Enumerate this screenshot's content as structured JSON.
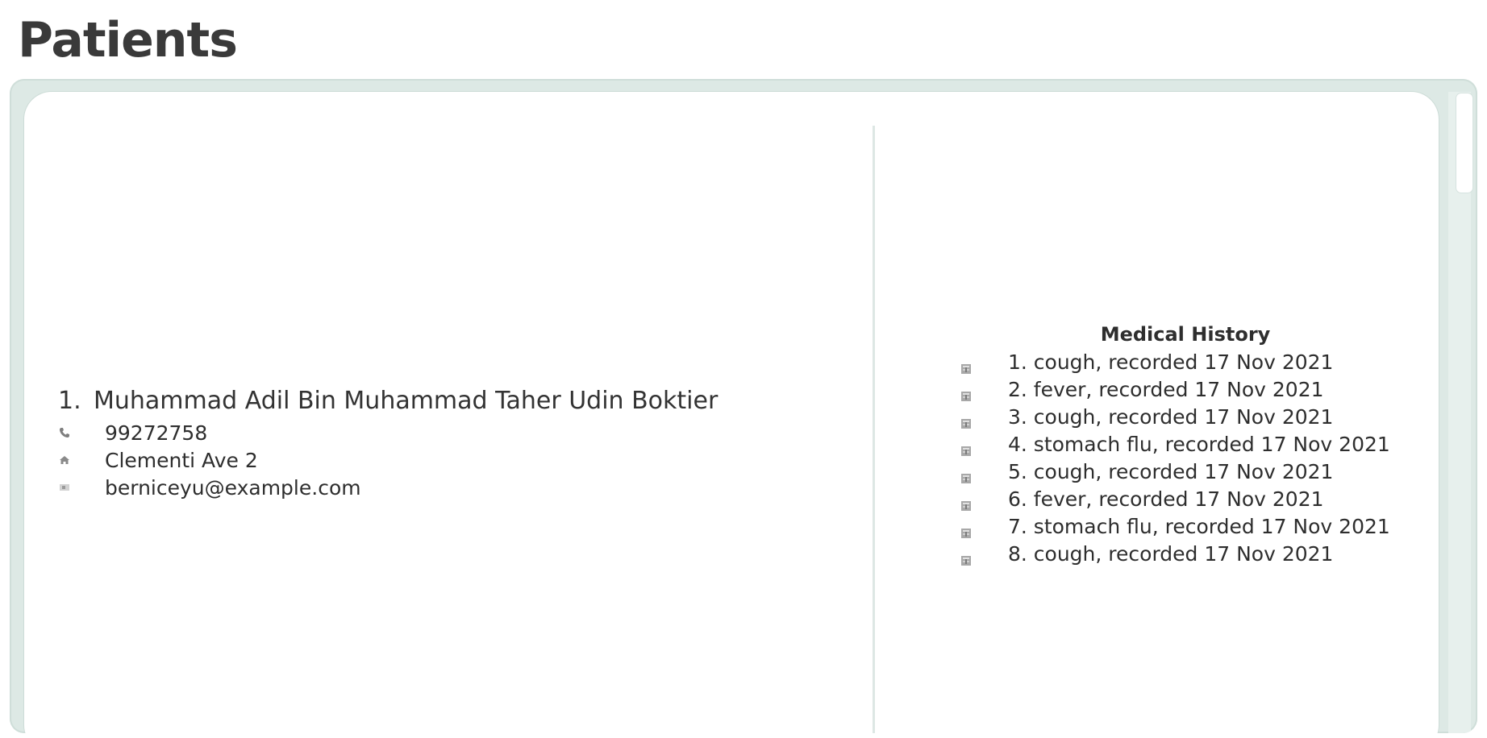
{
  "page": {
    "title": "Patients"
  },
  "patient": {
    "index": "1.",
    "name": "Muhammad Adil Bin Muhammad Taher Udin Boktier",
    "phone": "99272758",
    "address": "Clementi Ave 2",
    "email": "berniceyu@example.com",
    "icons": {
      "phone": "phone-icon",
      "address": "house-icon",
      "email": "email-icon"
    }
  },
  "medical_history": {
    "title": "Medical History",
    "icon": "medical-record-icon",
    "items": [
      "1. cough, recorded 17 Nov 2021",
      "2. fever, recorded 17 Nov 2021",
      "3. cough, recorded 17 Nov 2021",
      "4. stomach flu, recorded 17 Nov 2021",
      "5. cough, recorded 17 Nov 2021",
      "6. fever, recorded 17 Nov 2021",
      "7. stomach flu, recorded 17 Nov 2021",
      "8. cough, recorded 17 Nov 2021"
    ]
  },
  "colors": {
    "title": "#3a3a3a",
    "panel_background": "#dde9e5",
    "card_background": "#ffffff",
    "text": "#2e2e2e"
  }
}
